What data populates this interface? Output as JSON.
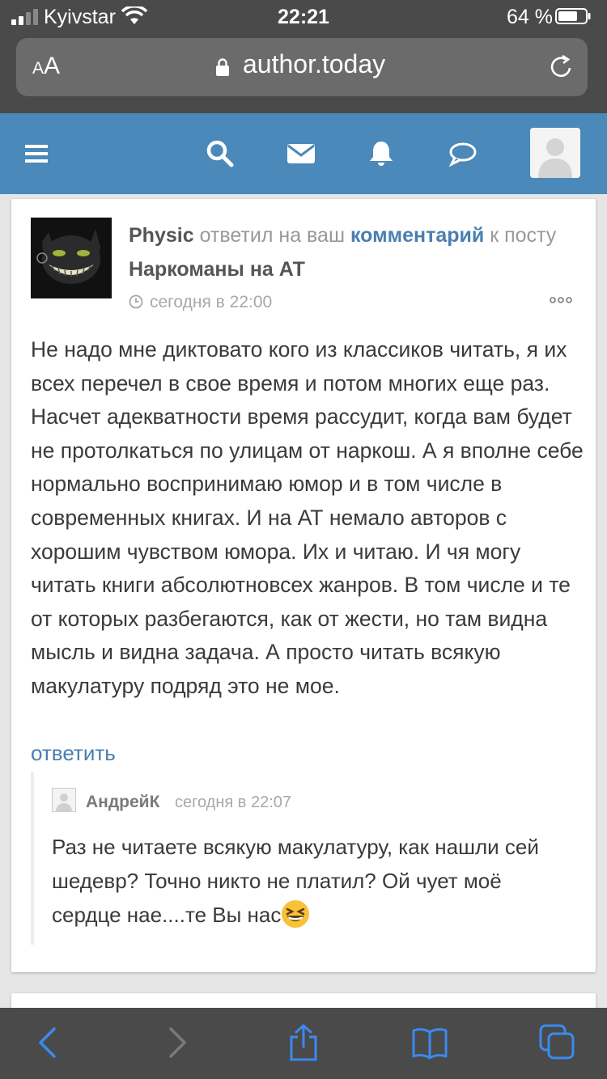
{
  "status_bar": {
    "carrier": "Kyivstar",
    "time": "22:21",
    "battery": "64 %"
  },
  "browser": {
    "text_size_small": "A",
    "text_size_large": "A",
    "domain": "author.today"
  },
  "header": {
    "icons": [
      "menu-icon",
      "search-icon",
      "mail-icon",
      "bell-icon",
      "chat-icon",
      "user-avatar"
    ],
    "color": "#4a89b9"
  },
  "notification": {
    "actor": "Physic",
    "action": "ответил на ваш",
    "comment_link": "комментарий",
    "to_post": "к посту",
    "post_title": "Наркоманы на АТ",
    "time": "сегодня в 22:00",
    "body": "Не надо мне диктовато кого из классиков читать, я их всех перечел в свое время и потом многих еще раз. Насчет адекватности время рассудит, когда вам будет не протолкаться по улицам от наркош. А я вполне себе нормально воспринимаю юмор и в том числе в современных книгах. И на АТ немало авторов с хорошим чувством юмора. Их и читаю. И чя могу читать книги абсолютновсех жанров. В том числе и те от которых разбегаются, как от жести, но там видна мысль и видна задача. А просто читать всякую макулатуру подряд это не мое.",
    "reply_label": "ответить"
  },
  "reply": {
    "author": "АндрейК",
    "time": "сегодня в 22:07",
    "body": "Раз не читаете всякую макулатуру, как нашли сей шедевр? Точно никто не платил? Ой чует моё сердце нае....те Вы нас",
    "emoji": "grinning-squinting-face"
  },
  "toolbar": {
    "icons": [
      "back-icon",
      "forward-icon",
      "share-icon",
      "bookmarks-icon",
      "tabs-icon"
    ]
  },
  "colors": {
    "accent": "#4a7fb0",
    "chrome": "#4a4a4a"
  }
}
